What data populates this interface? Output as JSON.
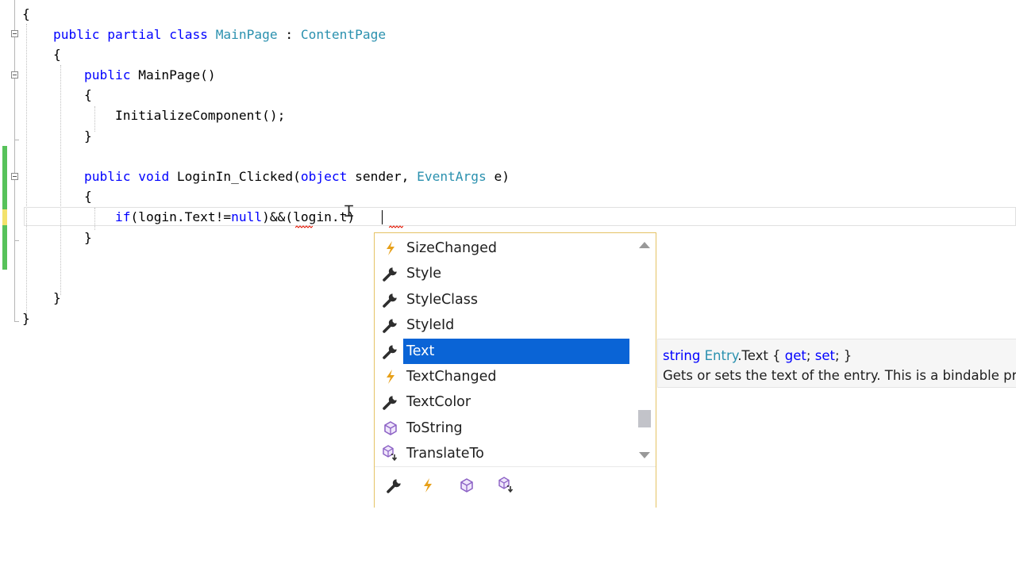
{
  "code": {
    "lines": [
      {
        "indent": "",
        "tokens": [
          {
            "t": "{",
            "c": ""
          }
        ]
      },
      {
        "indent": "    ",
        "tokens": [
          {
            "t": "public",
            "c": "kw"
          },
          {
            "t": " ",
            "c": ""
          },
          {
            "t": "partial",
            "c": "kw"
          },
          {
            "t": " ",
            "c": ""
          },
          {
            "t": "class",
            "c": "kw"
          },
          {
            "t": " ",
            "c": ""
          },
          {
            "t": "MainPage",
            "c": "ty"
          },
          {
            "t": " : ",
            "c": ""
          },
          {
            "t": "ContentPage",
            "c": "ty"
          }
        ]
      },
      {
        "indent": "    ",
        "tokens": [
          {
            "t": "{",
            "c": ""
          }
        ]
      },
      {
        "indent": "        ",
        "tokens": [
          {
            "t": "public",
            "c": "kw"
          },
          {
            "t": " MainPage()",
            "c": ""
          }
        ]
      },
      {
        "indent": "        ",
        "tokens": [
          {
            "t": "{",
            "c": ""
          }
        ]
      },
      {
        "indent": "            ",
        "tokens": [
          {
            "t": "InitializeComponent();",
            "c": ""
          }
        ]
      },
      {
        "indent": "        ",
        "tokens": [
          {
            "t": "}",
            "c": ""
          }
        ]
      },
      {
        "indent": "",
        "tokens": []
      },
      {
        "indent": "        ",
        "tokens": [
          {
            "t": "public",
            "c": "kw"
          },
          {
            "t": " ",
            "c": ""
          },
          {
            "t": "void",
            "c": "kw"
          },
          {
            "t": " LoginIn_Clicked(",
            "c": ""
          },
          {
            "t": "object",
            "c": "kw"
          },
          {
            "t": " sender, ",
            "c": ""
          },
          {
            "t": "EventArgs",
            "c": "ty"
          },
          {
            "t": " e)",
            "c": ""
          }
        ]
      },
      {
        "indent": "        ",
        "tokens": [
          {
            "t": "{",
            "c": ""
          }
        ]
      },
      {
        "indent": "            ",
        "tokens": [
          {
            "t": "if",
            "c": "kw"
          },
          {
            "t": "(login.Text!=",
            "c": ""
          },
          {
            "t": "null",
            "c": "kw"
          },
          {
            "t": ")&&(login.t)",
            "c": ""
          }
        ]
      },
      {
        "indent": "        ",
        "tokens": [
          {
            "t": "}",
            "c": ""
          }
        ]
      },
      {
        "indent": "",
        "tokens": []
      },
      {
        "indent": "",
        "tokens": []
      },
      {
        "indent": "    ",
        "tokens": [
          {
            "t": "}",
            "c": ""
          }
        ]
      },
      {
        "indent": "",
        "tokens": [
          {
            "t": "}",
            "c": ""
          }
        ]
      }
    ]
  },
  "completion": {
    "items": [
      {
        "label": "SizeChanged",
        "icon": "event-icon",
        "selected": false
      },
      {
        "label": "Style",
        "icon": "property-icon",
        "selected": false
      },
      {
        "label": "StyleClass",
        "icon": "property-icon",
        "selected": false
      },
      {
        "label": "StyleId",
        "icon": "property-icon",
        "selected": false
      },
      {
        "label": "Text",
        "icon": "property-icon",
        "selected": true
      },
      {
        "label": "TextChanged",
        "icon": "event-icon",
        "selected": false
      },
      {
        "label": "TextColor",
        "icon": "property-icon",
        "selected": false
      },
      {
        "label": "ToString",
        "icon": "method-icon",
        "selected": false
      },
      {
        "label": "TranslateTo",
        "icon": "extension-method-icon",
        "selected": false
      }
    ],
    "filters": [
      {
        "icon": "property-icon"
      },
      {
        "icon": "event-icon"
      },
      {
        "icon": "method-icon"
      },
      {
        "icon": "extension-method-icon"
      }
    ]
  },
  "tooltip": {
    "kw_string": "string",
    "type_name": "Entry",
    "member": ".Text { ",
    "kw_get": "get",
    "sep": "; ",
    "kw_set": "set",
    "end": "; }",
    "description": "Gets or sets the text of the entry. This is a bindable property."
  },
  "colors": {
    "keyword": "#0000ff",
    "type": "#2b91af",
    "selection": "#0a64d6",
    "change_saved": "#57c25a",
    "change_unsaved": "#f3e26b",
    "event_icon": "#e7a019",
    "method_icon": "#8a5fc4"
  }
}
